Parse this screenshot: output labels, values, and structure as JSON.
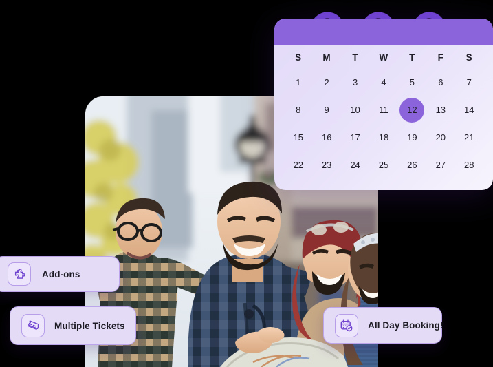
{
  "calendar": {
    "name": "booking-calendar",
    "header_color": "#8b64db",
    "body_color": "#e8e1fa",
    "selected_color": "#8b64db",
    "ring_count": 3,
    "weekdays": [
      "S",
      "M",
      "T",
      "W",
      "T",
      "F",
      "S"
    ],
    "weeks": [
      [
        "1",
        "2",
        "3",
        "4",
        "5",
        "6",
        "7"
      ],
      [
        "8",
        "9",
        "10",
        "11",
        "12",
        "13",
        "14"
      ],
      [
        "15",
        "16",
        "17",
        "18",
        "19",
        "20",
        "21"
      ],
      [
        "22",
        "23",
        "24",
        "25",
        "26",
        "27",
        "28"
      ]
    ],
    "selected_day": "12",
    "selected_row": 1,
    "selected_col": 4
  },
  "badges": [
    {
      "id": "addons",
      "label": "Add-ons",
      "icon": "puzzle-piece-icon"
    },
    {
      "id": "tickets",
      "label": "Multiple Tickets",
      "icon": "tickets-icon"
    },
    {
      "id": "allday",
      "label": "All Day Booking!",
      "icon": "calendar-check-icon"
    }
  ],
  "photo": {
    "alt": "Four smiling friends on a city street, one man pointing ahead while others hold a map",
    "accent": "#8b64db"
  }
}
